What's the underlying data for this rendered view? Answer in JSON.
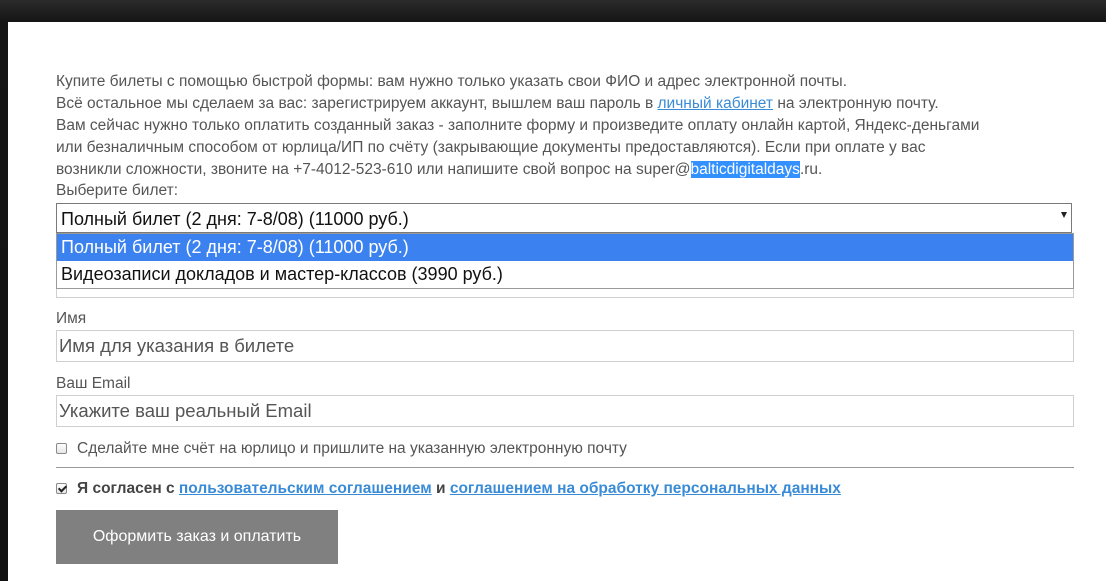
{
  "intro": {
    "line1": "Купите билеты с помощью быстрой формы: вам нужно только указать свои ФИО и адрес электронной почты.",
    "line2_before": "Всё остальное мы сделаем за вас: зарегистрируем аккаунт, вышлем ваш пароль в ",
    "line2_link": "личный кабинет",
    "line2_after": " на электронную почту.",
    "line3": "Вам сейчас нужно только оплатить созданный заказ - заполните форму и произведите оплату онлайн картой, Яндекс-деньгами",
    "line4": "или безналичным способом от юрлица/ИП по счёту (закрывающие документы предоставляются). Если при оплате у вас",
    "line5_before": "возникли сложности, звоните на +7-4012-523-610 или напишите свой вопрос на super@",
    "line5_highlight": "balticdigitaldays",
    "line5_after": ".ru."
  },
  "ticket": {
    "label": "Выберите билет:",
    "selected": "Полный билет (2 дня: 7-8/08) (11000 руб.)",
    "options": [
      "Полный билет (2 дня: 7-8/08) (11000 руб.)",
      "Видеозаписи докладов и мастер-классов (3990 руб.)"
    ]
  },
  "name_field": {
    "label": "Имя",
    "placeholder": "Имя для указания в билете"
  },
  "email_field": {
    "label": "Ваш Email",
    "placeholder": "Укажите ваш реальный Email"
  },
  "invoice_checkbox": {
    "label": "Сделайте мне счёт на юрлицо и пришлите на указанную электронную почту",
    "checked": false
  },
  "agreement": {
    "prefix": "Я согласен с ",
    "link1": "пользовательским соглашением",
    "middle": " и ",
    "link2": "соглашением на обработку персональных данных",
    "checked": true
  },
  "submit": {
    "label": "Оформить заказ и оплатить"
  },
  "colors": {
    "link": "#3a8bd6",
    "selection": "#3b82f0",
    "button": "#808080"
  }
}
